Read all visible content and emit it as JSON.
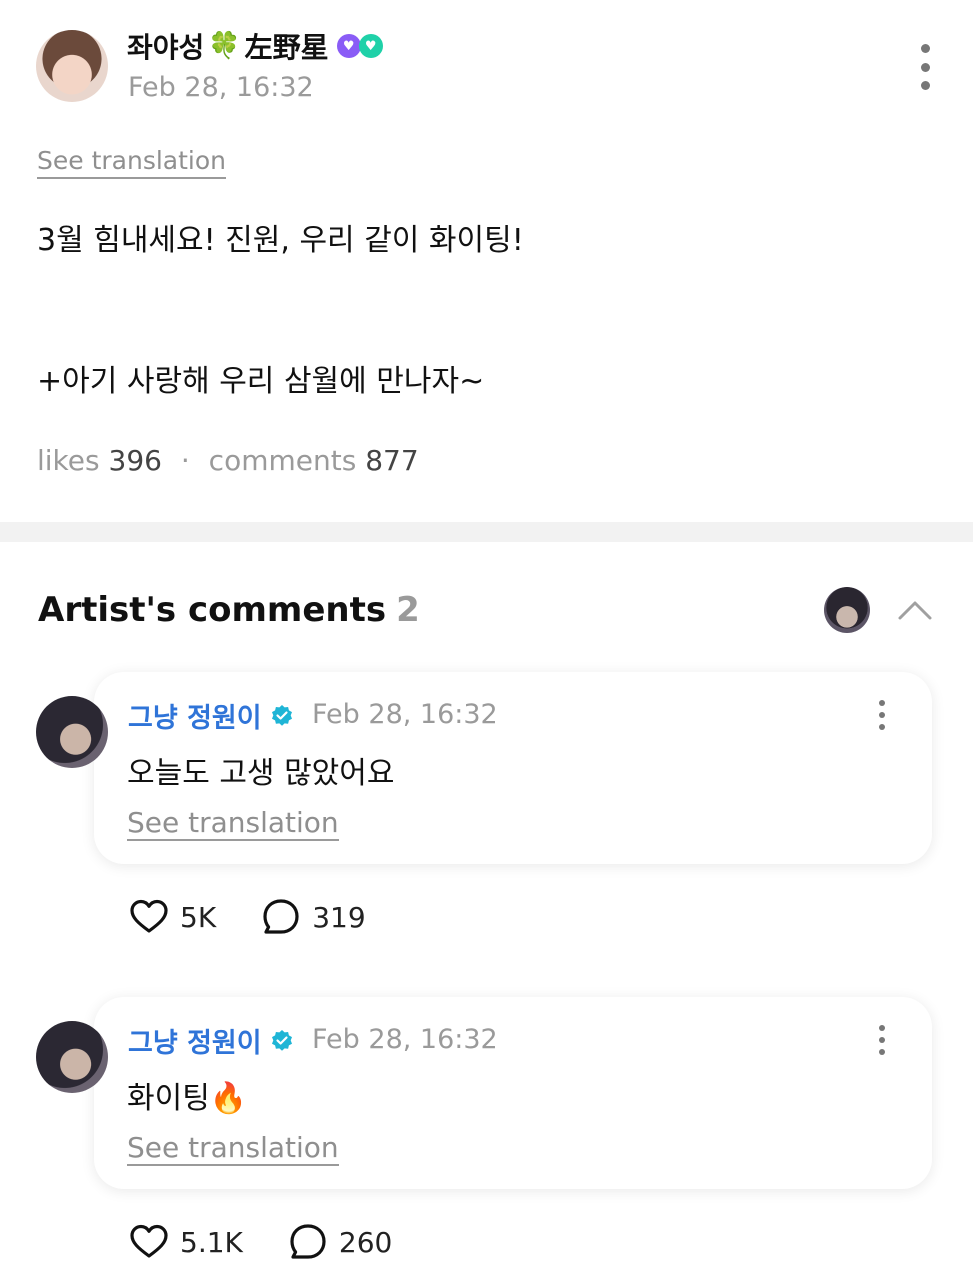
{
  "post": {
    "author_name": "좌야성",
    "author_suffix": "左野星",
    "emoji": "🍀",
    "date": "Feb 28, 16:32",
    "see_translation": "See translation",
    "body_line1": "3월 힘내세요! 진원, 우리 같이 화이팅!",
    "body_line2": "+아기 사랑해 우리 삼월에 만나자~",
    "likes_label": "likes",
    "likes_count": "396",
    "separator": "·",
    "comments_label": "comments",
    "comments_count": "877"
  },
  "artist_comments": {
    "title": "Artist's comments",
    "count": "2",
    "items": [
      {
        "name": "그냥 정원이",
        "date": "Feb 28, 16:32",
        "text": "오늘도 고생 많았어요",
        "see_translation": "See translation",
        "likes": "5K",
        "replies": "319"
      },
      {
        "name": "그냥 정원이",
        "date": "Feb 28, 16:32",
        "text": "화이팅🔥",
        "see_translation": "See translation",
        "likes": "5.1K",
        "replies": "260"
      }
    ]
  },
  "colors": {
    "accent_blue": "#2f74d8",
    "verified_teal": "#1fb5d6",
    "muted_gray": "#9a9a9a"
  },
  "icons": [
    "more-vertical-icon",
    "verified-icon",
    "heart-icon",
    "comment-bubble-icon",
    "chevron-up-icon",
    "clover-icon"
  ]
}
